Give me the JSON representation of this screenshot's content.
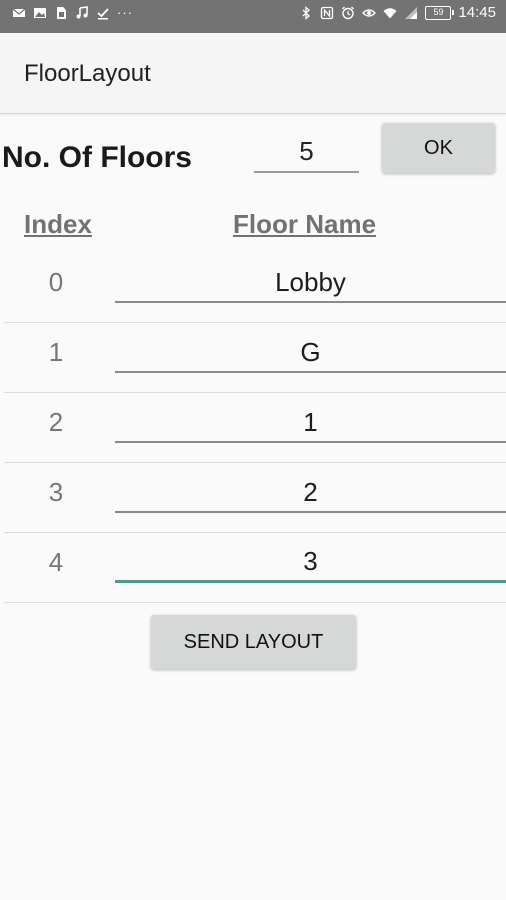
{
  "status_bar": {
    "left_icons": [
      "mail-icon",
      "image-icon",
      "sim-icon",
      "music-icon",
      "download-done-icon"
    ],
    "more_indicator": "···",
    "right_icons": [
      "bluetooth-icon",
      "nfc-icon",
      "alarm-icon",
      "eye-icon",
      "wifi-icon",
      "signal-icon"
    ],
    "battery": "59",
    "time": "14:45"
  },
  "app_bar": {
    "title": "FloorLayout"
  },
  "floor_count": {
    "label": "No. Of Floors",
    "value": "5",
    "ok_label": "OK"
  },
  "table": {
    "headers": {
      "index": "Index",
      "name": "Floor Name"
    },
    "rows": [
      {
        "index": "0",
        "name": "Lobby"
      },
      {
        "index": "1",
        "name": "G"
      },
      {
        "index": "2",
        "name": "1"
      },
      {
        "index": "3",
        "name": "2"
      },
      {
        "index": "4",
        "name": "3"
      }
    ]
  },
  "send_label": "SEND LAYOUT",
  "colors": {
    "status_bar": "#737373",
    "focused_underline": "#4f9a8f",
    "button_bg": "#d6d7d7"
  }
}
